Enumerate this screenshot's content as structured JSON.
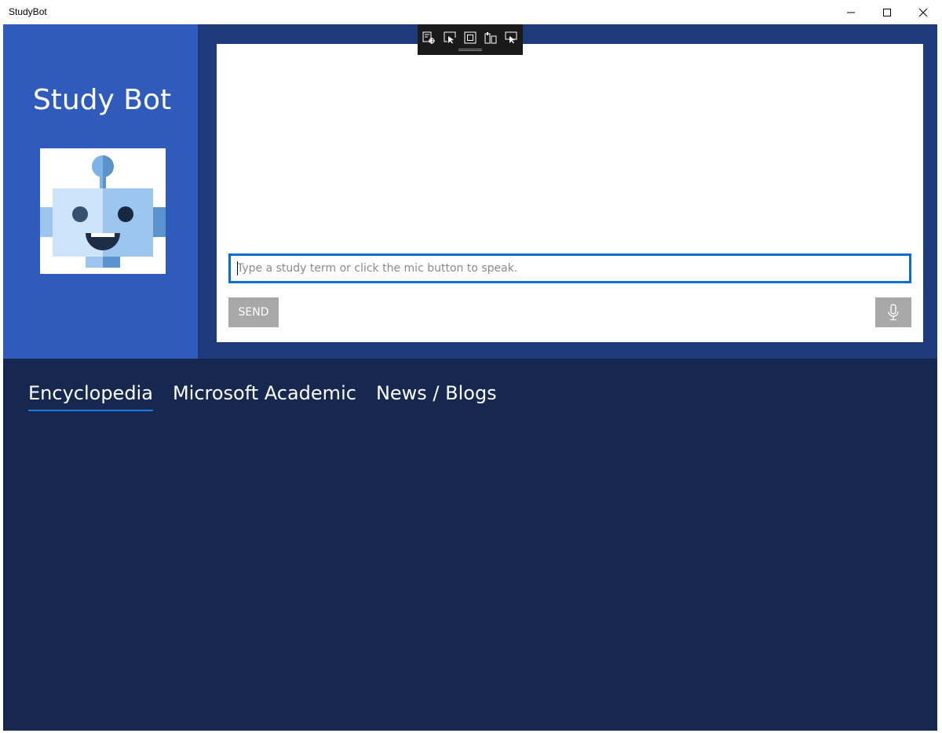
{
  "window": {
    "title": "StudyBot"
  },
  "sidebar": {
    "app_title": "Study Bot"
  },
  "chat": {
    "input_placeholder": "Type a study term or click the mic button to speak.",
    "input_value": "",
    "send_label": "SEND"
  },
  "tabs": [
    {
      "label": "Encyclopedia",
      "active": true
    },
    {
      "label": "Microsoft Academic",
      "active": false
    },
    {
      "label": "News / Blogs",
      "active": false
    }
  ],
  "colors": {
    "sidebar": "#2e5bbc",
    "top_band": "#1f3a7a",
    "bottom_area": "#172850",
    "accent": "#0a6fcc",
    "button_disabled": "#a8a8a8"
  }
}
